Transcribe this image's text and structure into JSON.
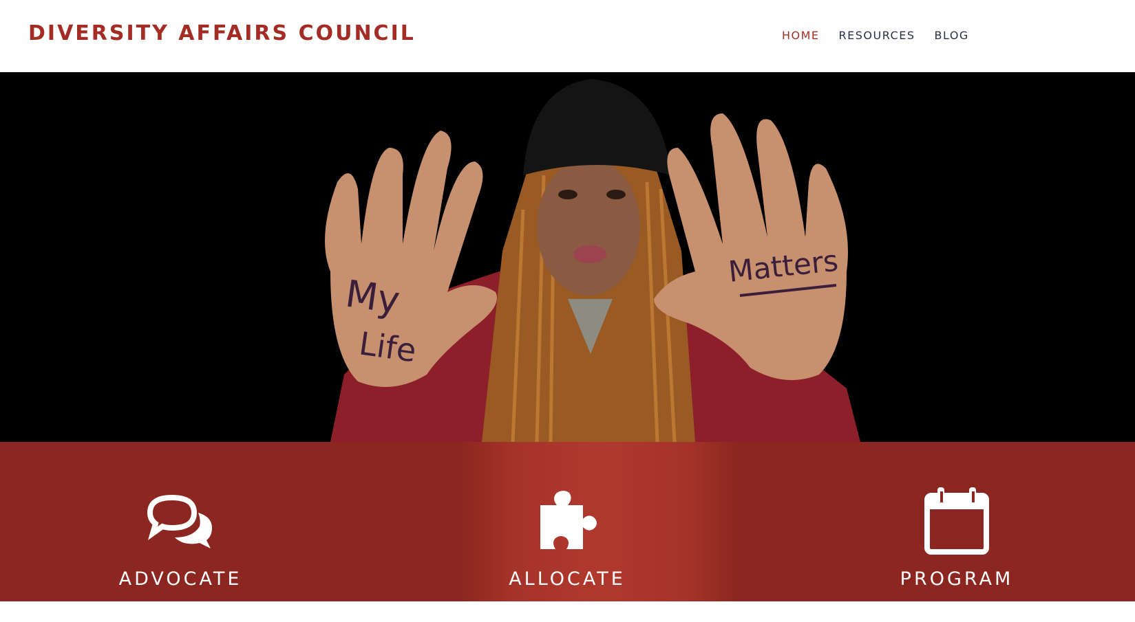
{
  "site": {
    "title": "DIVERSITY AFFAIRS COUNCIL",
    "brand_color": "#a32d24"
  },
  "nav": {
    "items": [
      {
        "label": "HOME",
        "active": true
      },
      {
        "label": "RESOURCES",
        "active": false
      },
      {
        "label": "BLOG",
        "active": false
      }
    ]
  },
  "hero": {
    "image": "Person holding up both palms toward the viewer",
    "left_hand_text": "My Life",
    "right_hand_text": "Matters",
    "background": "#000000"
  },
  "features": {
    "band_color": "#8b2720",
    "items": [
      {
        "label": "ADVOCATE",
        "icon": "chat-bubbles-icon"
      },
      {
        "label": "ALLOCATE",
        "icon": "puzzle-piece-icon"
      },
      {
        "label": "PROGRAM",
        "icon": "calendar-icon"
      }
    ]
  }
}
